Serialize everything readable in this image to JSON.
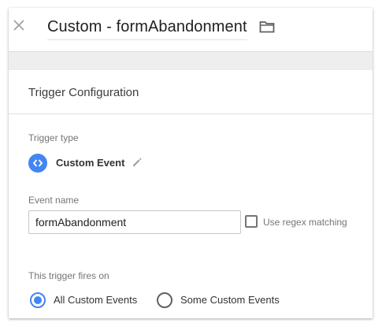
{
  "header": {
    "title": "Custom - formAbandonment",
    "close_icon": "close-icon",
    "folder_icon": "folder-icon"
  },
  "card": {
    "title": "Trigger Configuration",
    "trigger_type": {
      "label": "Trigger type",
      "value": "Custom Event",
      "icon": "code-brackets-icon",
      "edit_icon": "pencil-icon"
    },
    "event_name": {
      "label": "Event name",
      "value": "formAbandonment"
    },
    "regex": {
      "label": "Use regex matching",
      "checked": false
    },
    "fires_on": {
      "label": "This trigger fires on",
      "options": [
        {
          "label": "All Custom Events",
          "selected": true
        },
        {
          "label": "Some Custom Events",
          "selected": false
        }
      ]
    }
  },
  "colors": {
    "accent": "#4285f4",
    "background": "#eeeeee",
    "card": "#ffffff"
  }
}
